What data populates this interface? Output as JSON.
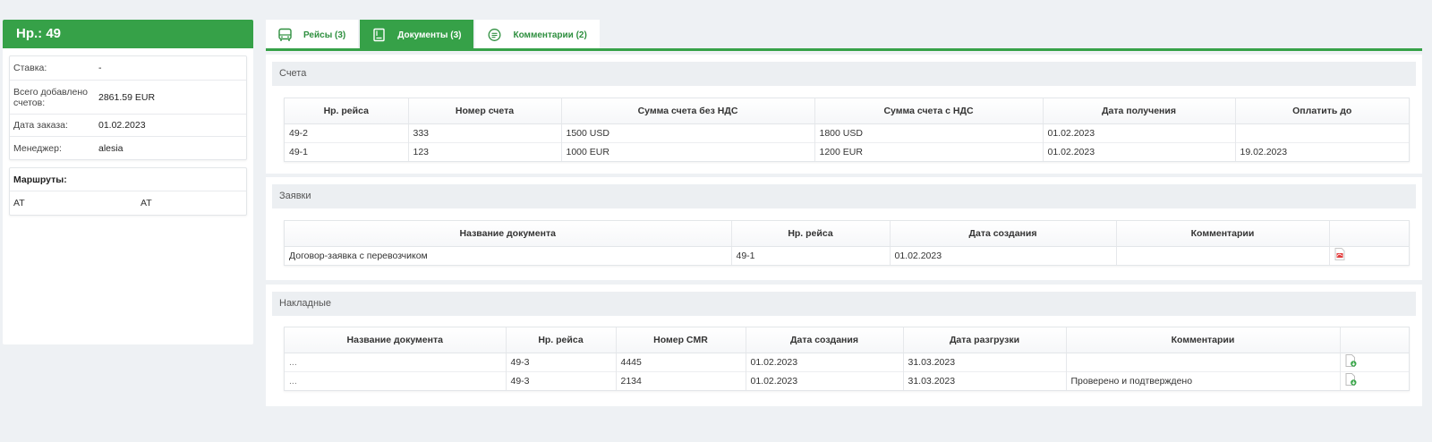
{
  "order": {
    "title": "Нр.: 49"
  },
  "info": [
    {
      "label": "Ставка:",
      "value": "-"
    },
    {
      "label": "Всего добавлено счетов:",
      "value": "2861.59 EUR"
    },
    {
      "label": "Дата заказа:",
      "value": "01.02.2023"
    },
    {
      "label": "Менеджер:",
      "value": "alesia"
    }
  ],
  "routes": {
    "title": "Маршруты:",
    "from": "AT",
    "to": "AT"
  },
  "tabs": [
    {
      "label": "Рейсы (3)",
      "icon": "bus-icon",
      "active": false
    },
    {
      "label": "Документы (3)",
      "icon": "document-icon",
      "active": true
    },
    {
      "label": "Комментарии (2)",
      "icon": "comment-icon",
      "active": false
    }
  ],
  "invoices": {
    "title": "Счета",
    "columns": [
      "Нр. рейса",
      "Номер счета",
      "Сумма счета без НДС",
      "Сумма счета с НДС",
      "Дата получения",
      "Оплатить до"
    ],
    "rows": [
      [
        "49-2",
        "333",
        "1500 USD",
        "1800 USD",
        "01.02.2023",
        ""
      ],
      [
        "49-1",
        "123",
        "1000 EUR",
        "1200 EUR",
        "01.02.2023",
        "19.02.2023"
      ]
    ]
  },
  "requests": {
    "title": "Заявки",
    "columns": [
      "Название документа",
      "Нр. рейса",
      "Дата создания",
      "Комментарии",
      ""
    ],
    "rows": [
      [
        "Договор-заявка с перевозчиком",
        "49-1",
        "01.02.2023",
        ""
      ]
    ]
  },
  "waybills": {
    "title": "Накладные",
    "columns": [
      "Название документа",
      "Нр. рейса",
      "Номер CMR",
      "Дата создания",
      "Дата разгрузки",
      "Комментарии",
      ""
    ],
    "rows": [
      [
        "...",
        "49-3",
        "4445",
        "01.02.2023",
        "31.03.2023",
        ""
      ],
      [
        "...",
        "49-3",
        "2134",
        "01.02.2023",
        "31.03.2023",
        "Проверено и подтверждено"
      ]
    ]
  },
  "colors": {
    "accent": "#36a148",
    "accent_text": "#2e8f3f",
    "background": "#eef1f4"
  }
}
